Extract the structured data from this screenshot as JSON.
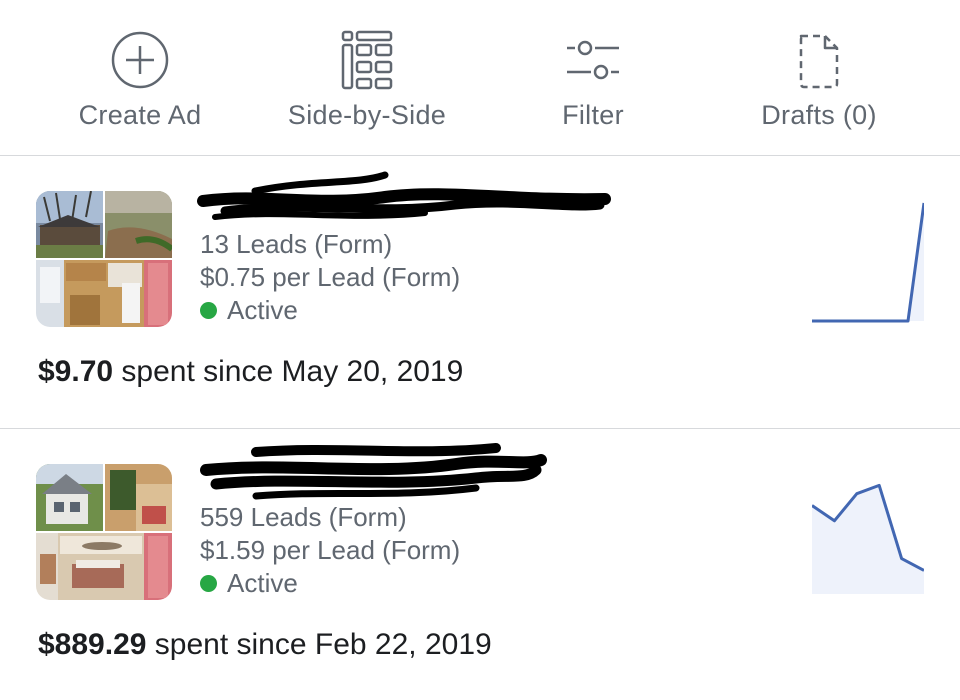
{
  "toolbar": {
    "create_ad": {
      "label": "Create Ad",
      "icon": "plus-circle-icon"
    },
    "side_by_side": {
      "label": "Side-by-Side",
      "icon": "side-by-side-icon"
    },
    "filter": {
      "label": "Filter",
      "icon": "filter-sliders-icon"
    },
    "drafts": {
      "label": "Drafts (0)",
      "icon": "document-icon"
    }
  },
  "ads": [
    {
      "title": "",
      "title_redacted": true,
      "leads": "13 Leads (Form)",
      "cost_per_lead": "$0.75 per Lead (Form)",
      "status": "Active",
      "spent_amount": "$9.70",
      "spent_text": "spent since May 20, 2019",
      "sparkline_trend": [
        0,
        0,
        0,
        0,
        0,
        0,
        0,
        1
      ]
    },
    {
      "title": "",
      "title_redacted": true,
      "leads": "559 Leads (Form)",
      "cost_per_lead": "$1.59 per Lead (Form)",
      "status": "Active",
      "spent_amount": "$889.29",
      "spent_text": "spent since Feb 22, 2019",
      "sparkline_trend": [
        0.75,
        0.62,
        0.85,
        0.92,
        0.3,
        0.2
      ]
    }
  ],
  "colors": {
    "accent": "#4267b2",
    "spark_fill": "#eef2fb",
    "status_active": "#27a744",
    "secondary_text": "#606770",
    "divider": "#d7d9dc"
  }
}
